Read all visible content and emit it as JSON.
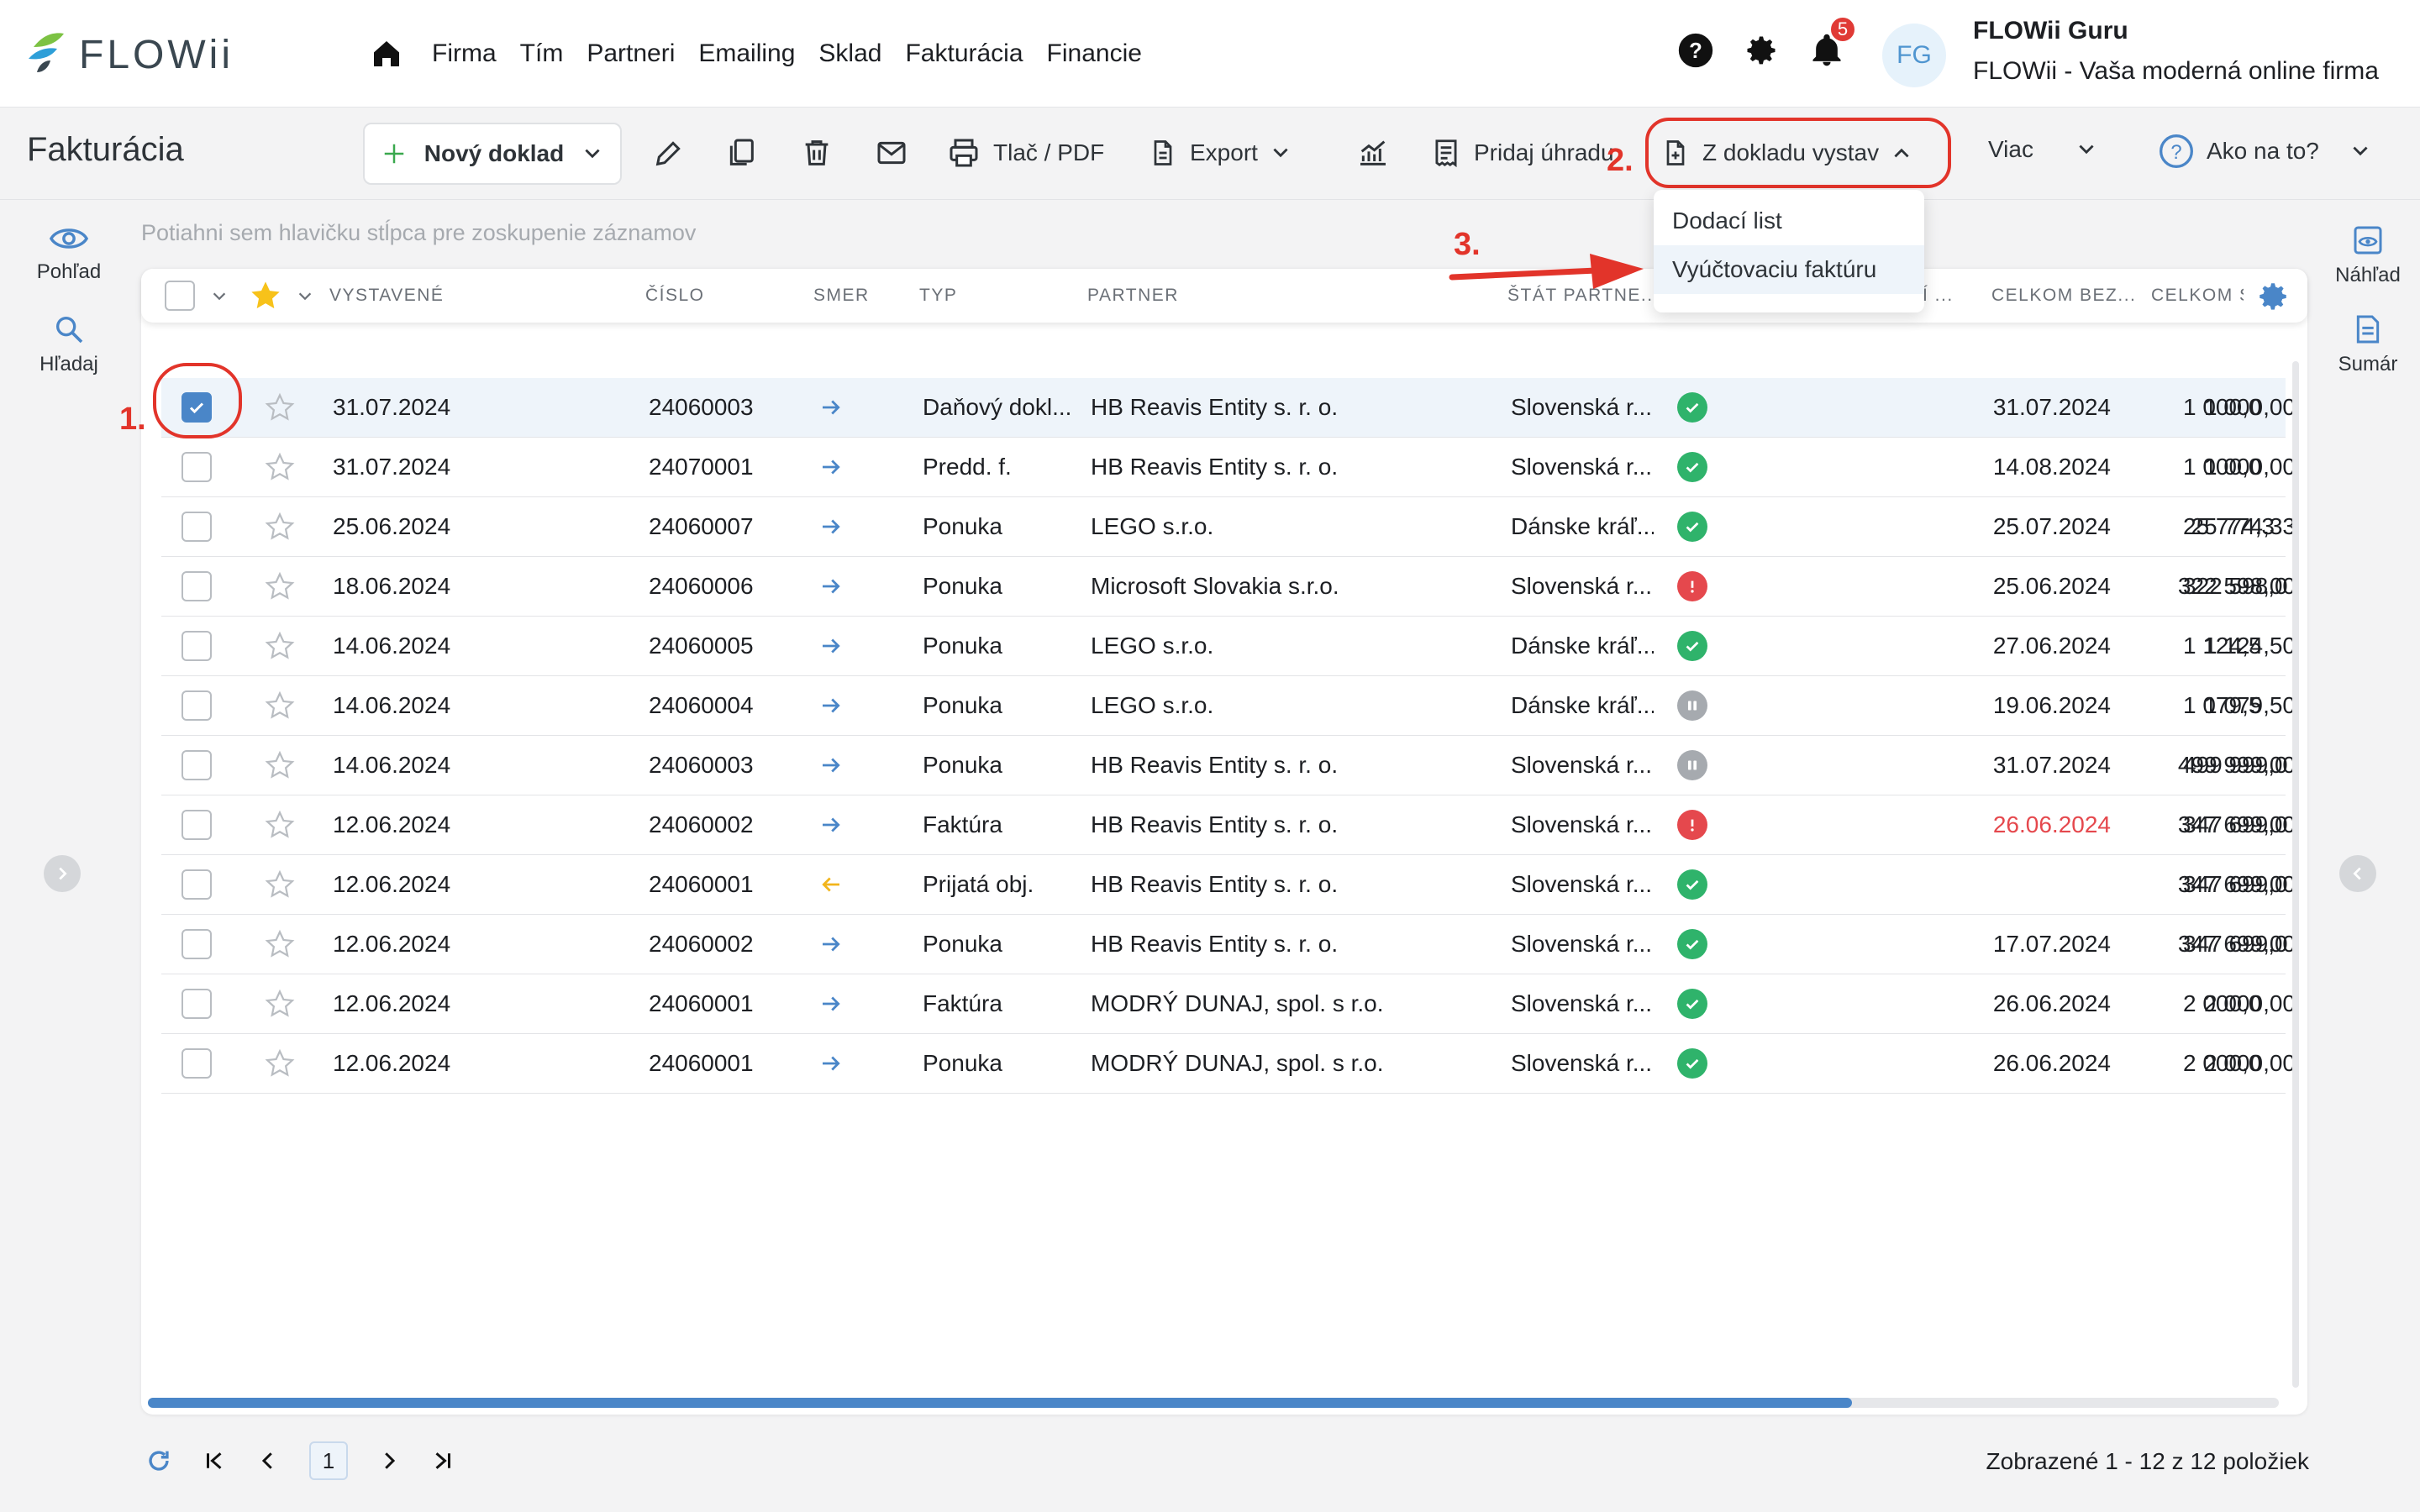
{
  "brand": {
    "name": "FLOWii"
  },
  "nav": {
    "items": [
      "Firma",
      "Tím",
      "Partneri",
      "Emailing",
      "Sklad",
      "Fakturácia",
      "Financie"
    ]
  },
  "notifications": {
    "count": "5"
  },
  "user": {
    "initials": "FG",
    "name": "FLOWii Guru",
    "tagline": "FLOWii - Vaša moderná online firma"
  },
  "toolbar": {
    "title": "Fakturácia",
    "new_doc": "Nový doklad",
    "print": "Tlač / PDF",
    "export": "Export",
    "add_payment": "Pridaj úhradu",
    "from_doc": "Z dokladu vystav",
    "more": "Viac",
    "help": "Ako na to?"
  },
  "dropdown": {
    "items": [
      "Dodací list",
      "Vyúčtovaciu faktúru"
    ],
    "active_index": 1
  },
  "annotations": {
    "step1": "1.",
    "step2": "2.",
    "step3": "3."
  },
  "rails": {
    "view": "Pohľad",
    "search": "Hľadaj",
    "preview": "Náhľad",
    "summary": "Sumár"
  },
  "grid": {
    "group_hint": "Potiahni sem hlavičku stĺpca pre zoskupenie záznamov",
    "columns": {
      "issued": "VYSTAVENÉ",
      "number": "ČÍSLO",
      "direction": "SMER",
      "type": "TYP",
      "partner": "PARTNER",
      "country": "ŠTÁT PARTNE...",
      "due_trunc": "Í ...",
      "total_excl": "CELKOM BEZ...",
      "total": "CELKOM S"
    },
    "rows": [
      {
        "issued": "31.07.2024",
        "number": "24060003",
        "dir": "out",
        "type": "Daňový dokl...",
        "partner": "HB Reavis Entity s. r. o.",
        "country": "Slovenská r...",
        "status": "ok",
        "due": "31.07.2024",
        "overdue": false,
        "total_excl": "1 000,00",
        "total": "1 000,0",
        "selected": true
      },
      {
        "issued": "31.07.2024",
        "number": "24070001",
        "dir": "out",
        "type": "Predd. f.",
        "partner": "HB Reavis Entity s. r. o.",
        "country": "Slovenská r...",
        "status": "ok",
        "due": "14.08.2024",
        "overdue": false,
        "total_excl": "1 000,00",
        "total": "1 000,0",
        "selected": false
      },
      {
        "issued": "25.06.2024",
        "number": "24060007",
        "dir": "out",
        "type": "Ponuka",
        "partner": "LEGO s.r.o.",
        "country": "Dánske kráľ...",
        "status": "ok",
        "due": "25.07.2024",
        "overdue": false,
        "total_excl": "25 774,33",
        "total": "25 774,3",
        "selected": false
      },
      {
        "issued": "18.06.2024",
        "number": "24060006",
        "dir": "out",
        "type": "Ponuka",
        "partner": "Microsoft Slovakia s.r.o.",
        "country": "Slovenská r...",
        "status": "err",
        "due": "25.06.2024",
        "overdue": false,
        "total_excl": "322 598,00",
        "total": "322 598,0",
        "selected": false
      },
      {
        "issued": "14.06.2024",
        "number": "24060005",
        "dir": "out",
        "type": "Ponuka",
        "partner": "LEGO s.r.o.",
        "country": "Dánske kráľ...",
        "status": "ok",
        "due": "27.06.2024",
        "overdue": false,
        "total_excl": "1 124,50",
        "total": "1 124,5",
        "selected": false
      },
      {
        "issued": "14.06.2024",
        "number": "24060004",
        "dir": "out",
        "type": "Ponuka",
        "partner": "LEGO s.r.o.",
        "country": "Dánske kráľ...",
        "status": "pause",
        "due": "19.06.2024",
        "overdue": false,
        "total_excl": "1 079,50",
        "total": "1 079,5",
        "selected": false
      },
      {
        "issued": "14.06.2024",
        "number": "24060003",
        "dir": "out",
        "type": "Ponuka",
        "partner": "HB Reavis Entity s. r. o.",
        "country": "Slovenská r...",
        "status": "pause",
        "due": "31.07.2024",
        "overdue": false,
        "total_excl": "499 999,00",
        "total": "499 999,0",
        "selected": false
      },
      {
        "issued": "12.06.2024",
        "number": "24060002",
        "dir": "out",
        "type": "Faktúra",
        "partner": "HB Reavis Entity s. r. o.",
        "country": "Slovenská r...",
        "status": "err",
        "due": "26.06.2024",
        "overdue": true,
        "total_excl": "347 699,00",
        "total": "347 699,0",
        "selected": false
      },
      {
        "issued": "12.06.2024",
        "number": "24060001",
        "dir": "in",
        "type": "Prijatá obj.",
        "partner": "HB Reavis Entity s. r. o.",
        "country": "Slovenská r...",
        "status": "ok",
        "due": "",
        "overdue": false,
        "total_excl": "347 699,00",
        "total": "347 699,0",
        "selected": false
      },
      {
        "issued": "12.06.2024",
        "number": "24060002",
        "dir": "out",
        "type": "Ponuka",
        "partner": "HB Reavis Entity s. r. o.",
        "country": "Slovenská r...",
        "status": "ok",
        "due": "17.07.2024",
        "overdue": false,
        "total_excl": "347 699,00",
        "total": "347 699,0",
        "selected": false
      },
      {
        "issued": "12.06.2024",
        "number": "24060001",
        "dir": "out",
        "type": "Faktúra",
        "partner": "MODRÝ DUNAJ, spol. s r.o.",
        "country": "Slovenská r...",
        "status": "ok",
        "due": "26.06.2024",
        "overdue": false,
        "total_excl": "2 000,00",
        "total": "2 000,0",
        "selected": false
      },
      {
        "issued": "12.06.2024",
        "number": "24060001",
        "dir": "out",
        "type": "Ponuka",
        "partner": "MODRÝ DUNAJ, spol. s r.o.",
        "country": "Slovenská r...",
        "status": "ok",
        "due": "26.06.2024",
        "overdue": false,
        "total_excl": "2 000,00",
        "total": "2 000,0",
        "selected": false
      }
    ]
  },
  "footer": {
    "current_page": "1",
    "count": "Zobrazené 1 - 12 z 12 položiek"
  },
  "colors": {
    "accent": "#4a86c8",
    "highlight": "#e2342a",
    "ok": "#2fb36b",
    "error": "#e5484d",
    "overdue_text": "#e5484d"
  }
}
